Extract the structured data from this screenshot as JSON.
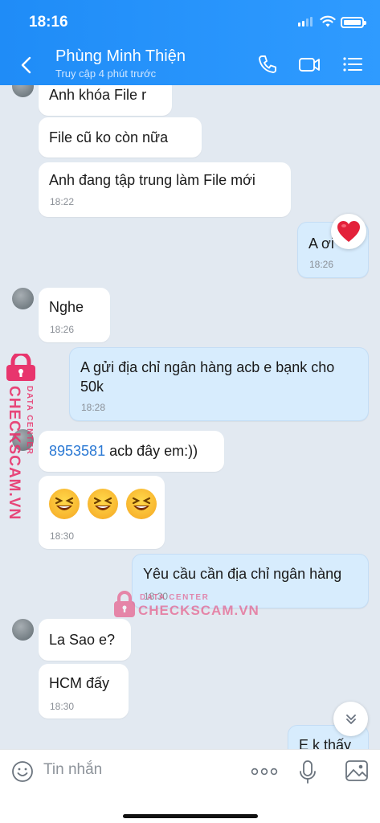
{
  "status_bar": {
    "time": "18:16"
  },
  "header": {
    "contact_name": "Phùng Minh Thiện",
    "contact_status": "Truy cập 4 phút trước",
    "icons": [
      "back-arrow-icon",
      "phone-icon",
      "video-call-icon",
      "menu-list-icon"
    ]
  },
  "messages": [
    {
      "dir": "in",
      "text": "Anh khóa  File r",
      "time": ""
    },
    {
      "dir": "in",
      "text": "File cũ  ko còn  nữa",
      "time": ""
    },
    {
      "dir": "in",
      "text": "Anh đang tập trung  làm  File mới",
      "time": "18:22"
    },
    {
      "dir": "out",
      "text": "A ơi",
      "time": "18:26",
      "reaction": "heart"
    },
    {
      "dir": "in",
      "text": "Nghe",
      "time": "18:26"
    },
    {
      "dir": "out",
      "text": "A gửi địa chỉ ngân hàng acb e bạnk cho 50k",
      "time": "18:28"
    },
    {
      "dir": "in",
      "link": "8953581",
      "text": " acb đây em:))",
      "time": ""
    },
    {
      "dir": "in",
      "emoji": "laughing x3",
      "time": "18:30"
    },
    {
      "dir": "out",
      "text": "Yêu cầu cần địa chỉ ngân hàng",
      "time": "18:30"
    },
    {
      "dir": "in",
      "text": "La Sao e?",
      "time": ""
    },
    {
      "dir": "in",
      "text": "HCM đấy",
      "time": "18:30"
    },
    {
      "dir": "out",
      "text": "E k thấy",
      "time": ""
    }
  ],
  "composer": {
    "placeholder": "Tin nhắn"
  },
  "watermark": {
    "line1": "DATA CENTER",
    "line2": "CHECKSCAM.VN",
    "color": "#e8356d"
  },
  "colors": {
    "header": "#2a95fb",
    "bubble_out": "#d7ecfd",
    "bubble_in": "#ffffff",
    "bg": "#e2e9f1"
  }
}
